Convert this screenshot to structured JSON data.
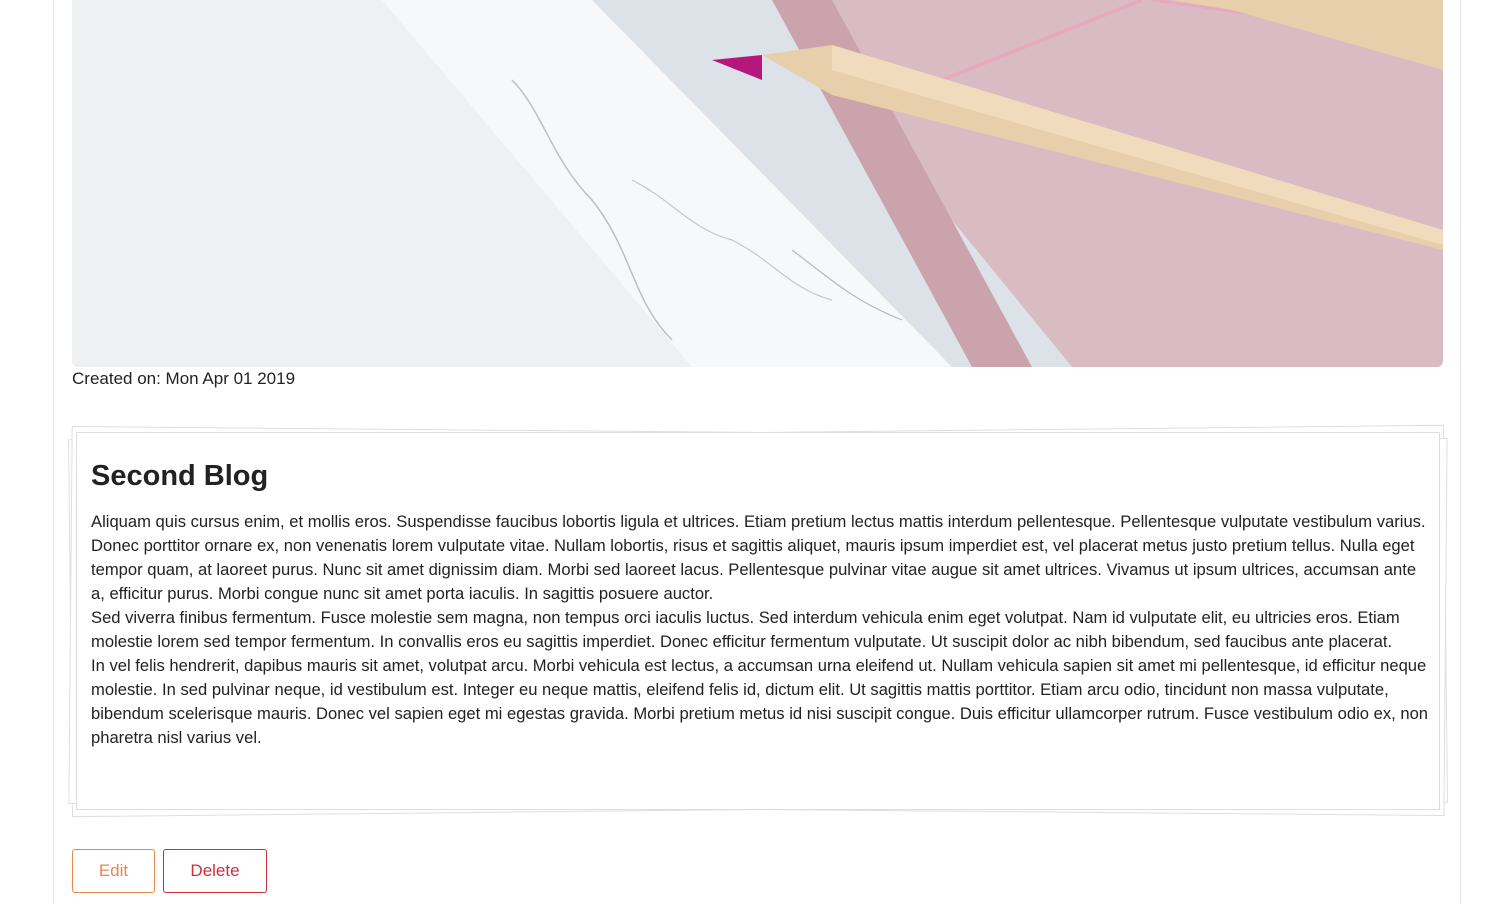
{
  "post": {
    "image_alt": "pencils on marble and pink notebook",
    "created_label": "Created on: Mon Apr 01 2019"
  },
  "card": {
    "title": "Second Blog",
    "paragraphs": [
      "Aliquam quis cursus enim, et mollis eros. Suspendisse faucibus lobortis ligula et ultrices. Etiam pretium lectus mattis interdum pellentesque. Pellentesque vulputate vestibulum varius. Donec porttitor ornare ex, non venenatis lorem vulputate vitae. Nullam lobortis, risus et sagittis aliquet, mauris ipsum imperdiet est, vel placerat metus justo pretium tellus. Nulla eget tempor quam, at laoreet purus. Nunc sit amet dignissim diam. Morbi sed laoreet lacus. Pellentesque pulvinar vitae augue sit amet ultrices. Vivamus ut ipsum ultrices, accumsan ante a, efficitur purus. Morbi congue nunc sit amet porta iaculis. In sagittis posuere auctor.",
      "Sed viverra finibus fermentum. Fusce molestie sem magna, non tempus orci iaculis luctus. Sed interdum vehicula enim eget volutpat. Nam id vulputate elit, eu ultricies eros. Etiam molestie lorem sed tempor fermentum. In convallis eros eu sagittis imperdiet. Donec efficitur fermentum vulputate. Ut suscipit dolor ac nibh bibendum, sed faucibus ante placerat.",
      "In vel felis hendrerit, dapibus mauris sit amet, volutpat arcu. Morbi vehicula est lectus, a accumsan urna eleifend ut. Nullam vehicula sapien sit amet mi pellentesque, id efficitur neque molestie. In sed pulvinar neque, id vestibulum est. Integer eu neque mattis, eleifend felis id, dictum elit. Ut sagittis mattis porttitor. Etiam arcu odio, tincidunt non massa vulputate, bibendum scelerisque mauris. Donec vel sapien eget mi egestas gravida. Morbi pretium metus id nisi suscipit congue. Duis efficitur ullamcorper rutrum. Fusce vestibulum odio ex, non pharetra nisl varius vel."
    ]
  },
  "actions": {
    "edit_label": "Edit",
    "delete_label": "Delete"
  },
  "colors": {
    "edit_accent": "#e8864f",
    "delete_accent": "#c9303a",
    "text": "#222222",
    "border": "#dedede"
  }
}
